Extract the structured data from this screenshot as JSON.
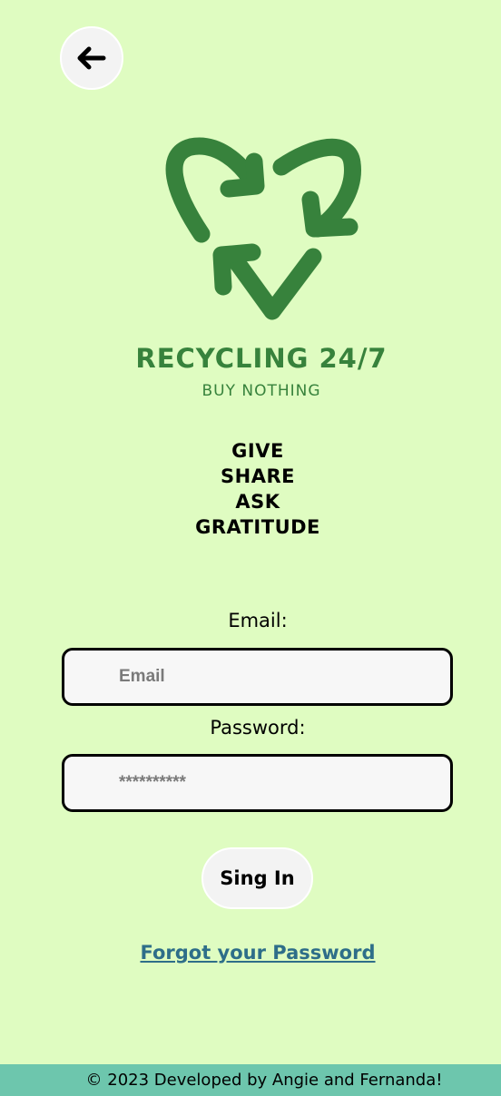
{
  "header": {
    "back_icon": "arrow-left-icon"
  },
  "brand": {
    "logo_icon": "recycle-icon",
    "logo_color": "#37823c",
    "title": "RECYCLING 24/7",
    "subtitle": "BUY NOTHING"
  },
  "mottos": [
    "GIVE",
    "SHARE",
    "ASK",
    "GRATITUDE"
  ],
  "form": {
    "email_label": "Email:",
    "email_placeholder": "Email",
    "email_value": "",
    "password_label": "Password:",
    "password_placeholder": "**********",
    "password_value": "",
    "submit_label": "Sing In",
    "forgot_label": "Forgot your Password"
  },
  "footer": {
    "text": "© 2023 Developed by Angie and Fernanda!"
  },
  "colors": {
    "background": "#dffcc1",
    "accent": "#37823c",
    "link": "#2e6e89",
    "footer": "#6dc6ad"
  }
}
